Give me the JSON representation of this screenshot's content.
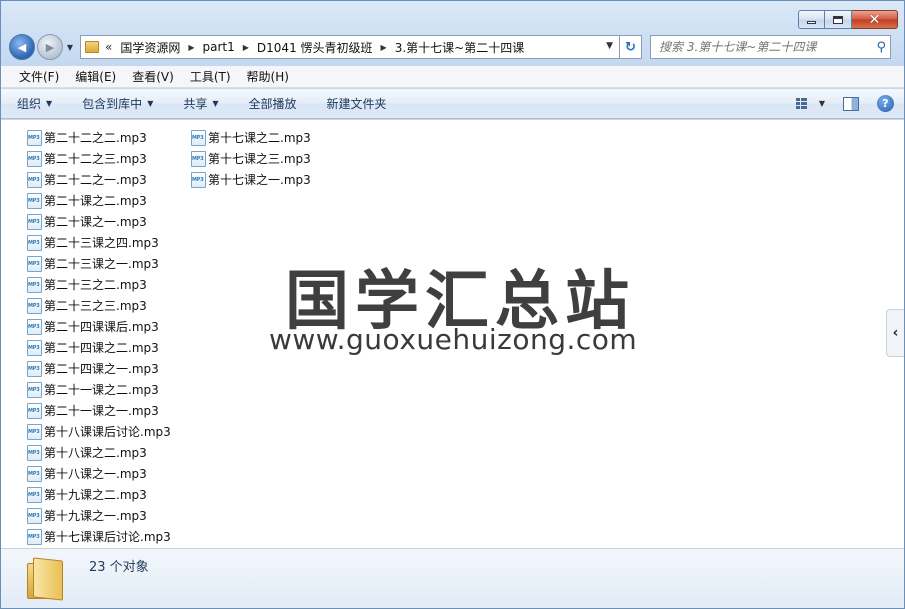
{
  "window": {
    "controls": {
      "min_icon": "minimize-icon",
      "max_icon": "maximize-icon",
      "close_glyph": "✕"
    }
  },
  "nav": {
    "back_glyph": "◀",
    "forward_glyph": "▶",
    "breadcrumb_overflow": "«",
    "breadcrumbs": [
      "国学资源网",
      "part1",
      "D1041 愣头青初级班",
      "3.第十七课~第二十四课"
    ],
    "refresh_glyph": "↻"
  },
  "search": {
    "placeholder": "搜索 3.第十七课~第二十四课"
  },
  "menu": [
    "文件(F)",
    "编辑(E)",
    "查看(V)",
    "工具(T)",
    "帮助(H)"
  ],
  "commands": {
    "organize": "组织",
    "include_in_library": "包含到库中",
    "share": "共享",
    "play_all": "全部播放",
    "new_folder": "新建文件夹",
    "help_glyph": "?"
  },
  "files_col1": [
    "第二十二之二.mp3",
    "第二十二之三.mp3",
    "第二十二之一.mp3",
    "第二十课之二.mp3",
    "第二十课之一.mp3",
    "第二十三课之四.mp3",
    "第二十三课之一.mp3",
    "第二十三之二.mp3",
    "第二十三之三.mp3",
    "第二十四课课后.mp3",
    "第二十四课之二.mp3",
    "第二十四课之一.mp3",
    "第二十一课之二.mp3",
    "第二十一课之一.mp3",
    "第十八课课后讨论.mp3",
    "第十八课之二.mp3",
    "第十八课之一.mp3",
    "第十九课之二.mp3",
    "第十九课之一.mp3",
    "第十七课课后讨论.mp3"
  ],
  "files_col2": [
    "第十七课之二.mp3",
    "第十七课之三.mp3",
    "第十七课之一.mp3"
  ],
  "watermark": {
    "cn": "国学汇总站",
    "en": "www.guoxuehuizong.com"
  },
  "side_tab_glyph": "‹",
  "details": {
    "count_text": "23 个对象"
  }
}
